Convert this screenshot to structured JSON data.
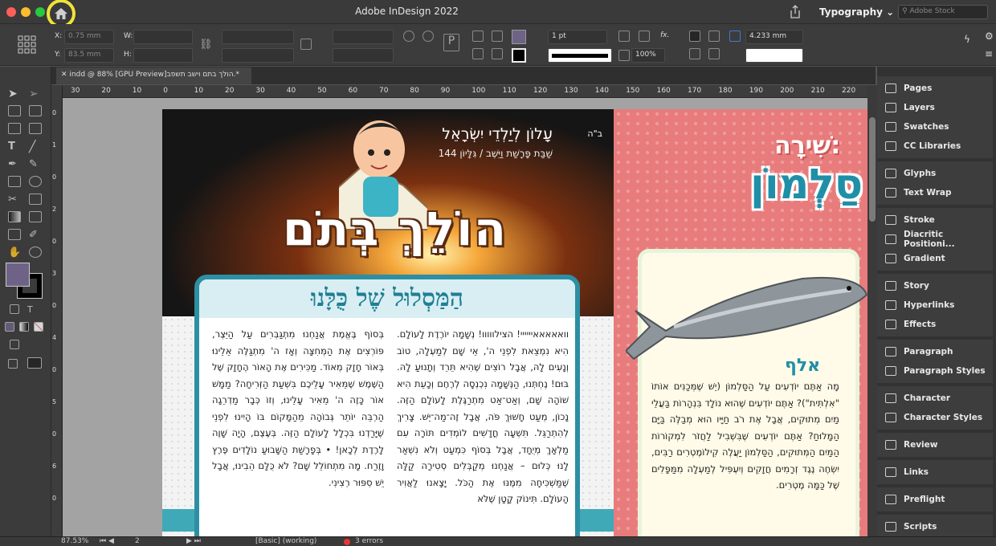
{
  "window": {
    "title": "Adobe InDesign 2022",
    "workspace": "Typography",
    "search_placeholder": "Adobe Stock"
  },
  "control_bar": {
    "x_label": "X:",
    "x_value": "0.75 mm",
    "y_label": "Y:",
    "y_value": "83.5 mm",
    "w_label": "W:",
    "h_label": "H:",
    "stroke_weight": "1 pt",
    "zoom_percent": "100%",
    "gap_value": "4.233 mm"
  },
  "document_tab": {
    "label": "indd @ 88% [GPU Preview]הולך בתם וישב תשפב.*"
  },
  "ruler": {
    "h_ticks": [
      "30",
      "20",
      "10",
      "0",
      "10",
      "20",
      "30",
      "40",
      "50",
      "60",
      "70",
      "80",
      "90",
      "100",
      "110",
      "120",
      "130",
      "140",
      "150",
      "160",
      "170",
      "180",
      "190",
      "200",
      "210",
      "220"
    ],
    "v_ticks": [
      "0",
      "1",
      "0",
      "2",
      "0",
      "3",
      "0",
      "4",
      "0",
      "5",
      "0",
      "6",
      "0"
    ]
  },
  "page1": {
    "bh": "ב\"ה",
    "masthead_line1": "עָלוֹן לְיַלְדֵי יִשְׂרָאֵל",
    "masthead_line2": "שַׁבַּת פָּרָשַׁת וַיֵּשֶׁב / גִּלָּיוֹן 144",
    "logo_text": "הוֹלֵךְ בְּתֹם",
    "card_title": "הַמַּסְלוּל שֶׁל כֻּלָּנוּ",
    "col_right": "וואאאאאיייייי! הצילווווו! נְשָׁמָה יוֹרֶדֶת לָעוֹלָם. הִיא נִמְצֵאת לִפְנֵי ה', אֵי שָׁם לְמַעְלָה, טוֹב וְנָעִים לָהּ, אֲבָל רוֹצִים שֶׁהִיא תֵּרֵד וְתָנוּעַ לָהּ. בּוּם! נֶחְתְּנוּ, הַנְּשָׁמָה נִכְנְסָה לְרֶחֶם וְכָעֵת הִיא שׁוֹהָה שָׁם, וְאַט־אַט מִתְרַגֶּלֶת לָעוֹלָם הַזֶּה. נָכוֹן, מְעַט חָשׁוּךְ פֹּה, אֲבָל זֶה־מַה־יֵּשׁ. צָרִיךְ לְהִתְרַגֵּל. תִּשְׁעָה חֳדָשִׁים לוֹמְדִים תּוֹרָה עִם מַלְאָךְ מְיֻחָד, אֲבָל בְּסוֹף כִּמְעַט וְלֹא נִשְׁאַר לָנוּ כְּלוּם – אֲנַחְנוּ מְקַבְּלִים סְטִירָה קַלָּה שֶׁמַּשְׁכִּיחָה מִמֶּנּוּ אֶת הַכֹּל. יָצָאנוּ לַאֲוִיר הָעוֹלָם. תִּינוֹק קָטָן שֶׁלֹּא",
    "col_left": "בְּסוֹף בֶּאֱמֶת אֲנַחְנוּ מִתְגַּבְּרִים עַל הַיֵּצֶר, פּוֹרְצִים אֶת הַמְּחִצָּה וְאָז ה' מִתְגַּלֶּה אֵלֵינוּ בְּאוֹר חָזָק מְאוֹד. מַכִּירִים אֶת הָאוֹר הֶחָזָק שֶׁל הַשֶּׁמֶשׁ שֶׁמֵּאִיר עָלֵיכֶם בִּשְׁעַת הַזְּרִיחָה? מַמָּשׁ אוֹר כָּזֶה ה' מֵאִיר עָלֵינוּ, וְזוֹ כְּבָר מַדְרֵגָה הַרְבֵּה יוֹתֵר גְּבוֹהָה מֵהַמָּקוֹם בּוֹ הָיִינוּ לִפְנֵי שֶׁיָּרַדְנוּ בִּכְלָל לָעוֹלָם הַזֶּה. בְּעֶצֶם, הָיָה שָׁוֶה לָרֶדֶת לְכָאן! • בְּפָרָשַׁת הַשָּׁבוּעַ נוֹלָדִים פֶּרֶץ וָזֶרַח. מָה מִתְחוֹלֵל שָׁם? לֹא כֻּלָּם הֵבִינוּ, אֲבָל יֵשׁ סִפּוּר רְצִינִי."
  },
  "page2": {
    "title_line1": "שִׁירָה:",
    "title_line2": "סַלְמוֹן",
    "alef": "אלף",
    "text": "מָה אַתֶּם יוֹדְעִים עַל הַסַּלְמוֹן (יֵשׁ שֶׁמְּכַנִּים אוֹתוֹ \"אִלְתִּית\")? אַתֶּם יוֹדְעִים שֶׁהוּא נוֹלָד בִּנְהָרוֹת בַּעֲלֵי מַיִם מְתוּקִים, אֲבָל אֶת רֹב חַיָּיו הוּא מְבַלֶּה בַּיָּם הַמָּלוּחַ? אַתֶּם יוֹדְעִים שֶׁבִּשְׁבִיל לַחֲזֹר לִמְקוֹרוֹת הַמַּיִם הַמְּתוּקִים, הַסַּלְמוֹן יַעֲלֶה קִילוֹמֶטְרִים רַבִּים, יִשְׂחֶה נֶגֶד זְרָמִים חֲזָקִים וְיִעְפִּיל לְמַעְלָה מִמַּפָּלִים שֶׁל כַּמָּה מֶטְרִים."
  },
  "panels": [
    {
      "items": [
        {
          "label": "Pages",
          "icon": "pages-icon"
        },
        {
          "label": "Layers",
          "icon": "layers-icon"
        },
        {
          "label": "Swatches",
          "icon": "swatches-icon"
        },
        {
          "label": "CC Libraries",
          "icon": "cc-libraries-icon"
        }
      ]
    },
    {
      "items": [
        {
          "label": "Glyphs",
          "icon": "glyphs-icon"
        },
        {
          "label": "Text Wrap",
          "icon": "text-wrap-icon"
        }
      ]
    },
    {
      "items": [
        {
          "label": "Stroke",
          "icon": "stroke-icon"
        },
        {
          "label": "Diacritic Positioni...",
          "icon": "diacritic-icon"
        },
        {
          "label": "Gradient",
          "icon": "gradient-icon"
        }
      ]
    },
    {
      "items": [
        {
          "label": "Story",
          "icon": "story-icon"
        },
        {
          "label": "Hyperlinks",
          "icon": "hyperlinks-icon"
        },
        {
          "label": "Effects",
          "icon": "effects-icon"
        }
      ]
    },
    {
      "items": [
        {
          "label": "Paragraph",
          "icon": "paragraph-icon"
        },
        {
          "label": "Paragraph Styles",
          "icon": "paragraph-styles-icon"
        }
      ]
    },
    {
      "items": [
        {
          "label": "Character",
          "icon": "character-icon"
        },
        {
          "label": "Character Styles",
          "icon": "character-styles-icon"
        }
      ]
    },
    {
      "items": [
        {
          "label": "Review",
          "icon": "review-icon"
        }
      ]
    },
    {
      "items": [
        {
          "label": "Links",
          "icon": "links-icon"
        }
      ]
    },
    {
      "items": [
        {
          "label": "Preflight",
          "icon": "preflight-icon"
        }
      ]
    },
    {
      "items": [
        {
          "label": "Scripts",
          "icon": "scripts-icon"
        }
      ]
    }
  ],
  "status_bar": {
    "zoom": "87.53%",
    "page": "2",
    "profile": "[Basic] (working)",
    "errors": "3 errors"
  },
  "colors": {
    "fill_swatch": "#6e6387",
    "highlight_ring": "#f0e33a",
    "brand_teal": "#1f7f95",
    "salmon": "#e87c7c"
  }
}
